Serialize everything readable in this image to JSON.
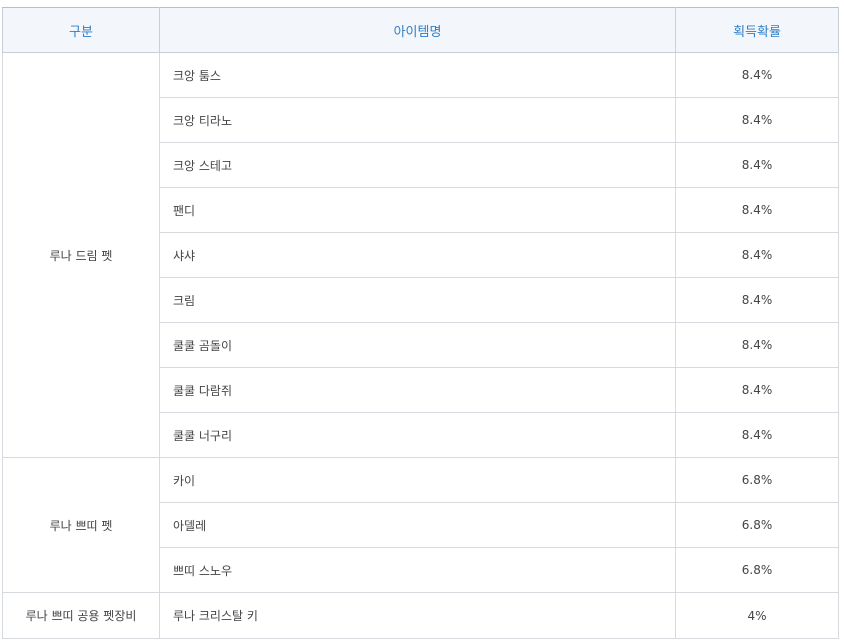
{
  "table": {
    "headers": [
      "구분",
      "아이템명",
      "획득확률"
    ],
    "groups": [
      {
        "category": "루나 드림 펫",
        "items": [
          {
            "name": "크앙 툼스",
            "rate": "8.4%"
          },
          {
            "name": "크앙 티라노",
            "rate": "8.4%"
          },
          {
            "name": "크앙 스테고",
            "rate": "8.4%"
          },
          {
            "name": "팬디",
            "rate": "8.4%"
          },
          {
            "name": "샤샤",
            "rate": "8.4%"
          },
          {
            "name": "크림",
            "rate": "8.4%"
          },
          {
            "name": "쿨쿨 곰돌이",
            "rate": "8.4%"
          },
          {
            "name": "쿨쿨 다람쥐",
            "rate": "8.4%"
          },
          {
            "name": "쿨쿨 너구리",
            "rate": "8.4%"
          }
        ]
      },
      {
        "category": "루나 쁘띠 펫",
        "items": [
          {
            "name": "카이",
            "rate": "6.8%"
          },
          {
            "name": "아델레",
            "rate": "6.8%"
          },
          {
            "name": "쁘띠 스노우",
            "rate": "6.8%"
          }
        ]
      },
      {
        "category": "루나 쁘띠 공용 펫장비",
        "items": [
          {
            "name": "루나 크리스탈 키",
            "rate": "4%"
          }
        ]
      }
    ]
  }
}
